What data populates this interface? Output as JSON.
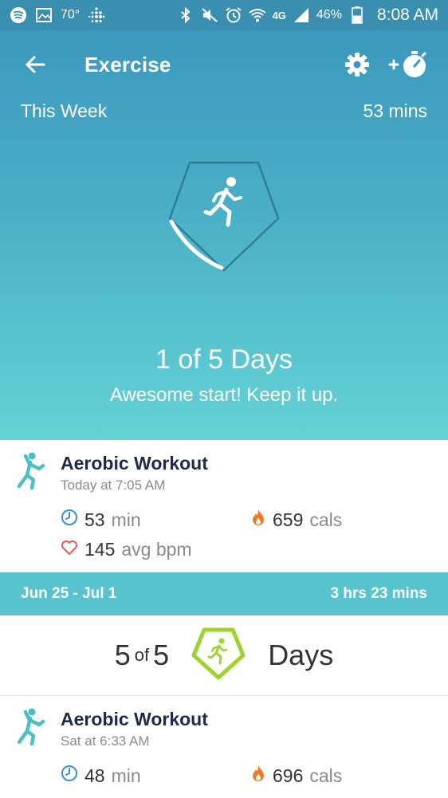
{
  "status_bar": {
    "temperature": "70°",
    "network": "4G",
    "battery": "46%",
    "time": "8:08 AM"
  },
  "app_bar": {
    "title": "Exercise"
  },
  "summary": {
    "period_label": "This Week",
    "total": "53 mins",
    "days_progress": "1 of 5 Days",
    "message": "Awesome start! Keep it up.",
    "progress_fraction": 0.2,
    "page_count": 6,
    "active_page": 1
  },
  "workouts_current": [
    {
      "name": "Aerobic Workout",
      "time": "Today at 7:05 AM",
      "duration_value": "53",
      "duration_unit": "min",
      "calories_value": "659",
      "calories_unit": "cals",
      "heart_value": "145",
      "heart_unit": "avg bpm"
    }
  ],
  "week_range": {
    "dates": "Jun 25 - Jul 1",
    "total": "3 hrs 23 mins",
    "days_done": "5",
    "of_label": "of",
    "days_goal": "5",
    "days_label": "Days"
  },
  "workouts_past": [
    {
      "name": "Aerobic Workout",
      "time": "Sat at 6:33 AM",
      "duration_value": "48",
      "duration_unit": "min",
      "calories_value": "696",
      "calories_unit": "cals"
    }
  ],
  "colors": {
    "header_top": "#3a8eb0",
    "gradient_bottom": "#65d2d5",
    "accent_teal": "#58c3cc",
    "goal_green": "#9ed32f",
    "calorie_orange": "#f07a22",
    "heart_red": "#e85a4f",
    "clock_blue": "#3a8fd1"
  }
}
